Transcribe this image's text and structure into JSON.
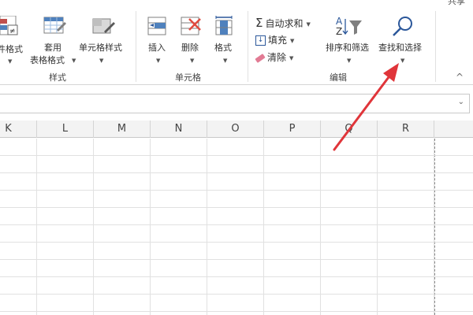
{
  "ribbon": {
    "corner_text": "共享",
    "collapse_glyph": "^",
    "styles_group": {
      "label": "样式",
      "conditional_format_label": "件格式",
      "table_format_label_1": "套用",
      "table_format_label_2": "表格格式",
      "cell_style_label": "单元格样式"
    },
    "cells_group": {
      "label": "单元格",
      "insert_label": "插入",
      "delete_label": "删除",
      "format_label": "格式"
    },
    "editing_group": {
      "label": "编辑",
      "autosum_label": "自动求和",
      "fill_label": "填充",
      "clear_label": "清除",
      "sort_filter_label": "排序和筛选",
      "find_select_label": "查找和选择"
    }
  },
  "formula_bar": {
    "value": "",
    "expand_glyph": "⌄"
  },
  "sheet": {
    "columns": [
      "K",
      "L",
      "M",
      "N",
      "O",
      "P",
      "Q",
      "R"
    ]
  },
  "colors": {
    "annotation_arrow": "#e0353a",
    "accent_blue": "#2b579a"
  }
}
